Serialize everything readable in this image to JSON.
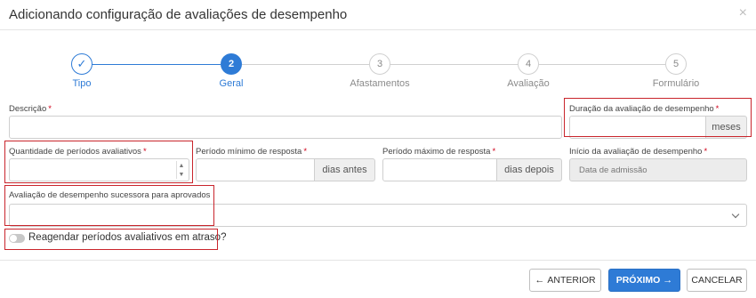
{
  "dialog": {
    "title": "Adicionando configuração de avaliações de desempenho",
    "close_glyph": "×"
  },
  "stepper": {
    "steps": [
      {
        "number": "✓",
        "label": "Tipo",
        "state": "done"
      },
      {
        "number": "2",
        "label": "Geral",
        "state": "active"
      },
      {
        "number": "3",
        "label": "Afastamentos",
        "state": "pending"
      },
      {
        "number": "4",
        "label": "Avaliação",
        "state": "pending"
      },
      {
        "number": "5",
        "label": "Formulário",
        "state": "pending"
      }
    ]
  },
  "form": {
    "descricao": {
      "label": "Descrição",
      "required": "*",
      "value": ""
    },
    "duracao": {
      "label": "Duração da avaliação de desempenho",
      "required": "*",
      "value": "",
      "suffix": "meses"
    },
    "quantidade": {
      "label": "Quantidade de períodos avaliativos",
      "required": "*",
      "value": ""
    },
    "periodo_minimo": {
      "label": "Período mínimo de resposta",
      "required": "*",
      "value": "",
      "suffix": "dias antes"
    },
    "periodo_maximo": {
      "label": "Período máximo de resposta",
      "required": "*",
      "value": "",
      "suffix": "dias depois"
    },
    "inicio": {
      "label": "Início da avaliação de desempenho",
      "required": "*",
      "value": "Data de admissão"
    },
    "sucessora": {
      "label": "Avaliação de desempenho sucessora para aprovados",
      "value": ""
    },
    "reagendar": {
      "label": "Reagendar períodos avaliativos em atraso?",
      "checked": false
    }
  },
  "footer": {
    "anterior": "ANTERIOR",
    "anterior_icon": "←",
    "proximo": "PRÓXIMO",
    "proximo_icon": "→",
    "cancelar": "CANCELAR"
  },
  "colors": {
    "primary": "#2e7bd6",
    "required": "#d0021b",
    "highlight": "#c9252c",
    "inactive": "#9e9e9e"
  }
}
